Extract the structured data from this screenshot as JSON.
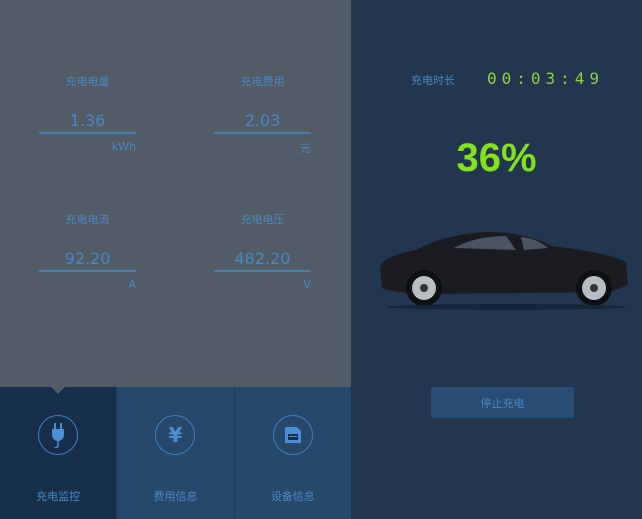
{
  "metrics": [
    {
      "label": "充电电量",
      "value": "1.36",
      "unit": "kWh"
    },
    {
      "label": "充电费用",
      "value": "2.03",
      "unit": "元"
    },
    {
      "label": "充电电流",
      "value": "92.20",
      "unit": "A"
    },
    {
      "label": "充电电压",
      "value": "482.20",
      "unit": "V"
    }
  ],
  "nav": [
    {
      "label": "充电监控",
      "icon": "plug-icon"
    },
    {
      "label": "费用信息",
      "icon": "yen-icon"
    },
    {
      "label": "设备信息",
      "icon": "floppy-disk-icon"
    }
  ],
  "status": {
    "duration_label": "充电时长",
    "duration": "00:03:49",
    "percent": "36%",
    "stop_label": "停止充电"
  },
  "colors": {
    "accent": "#4a86c0",
    "percent": "#84e21b"
  }
}
